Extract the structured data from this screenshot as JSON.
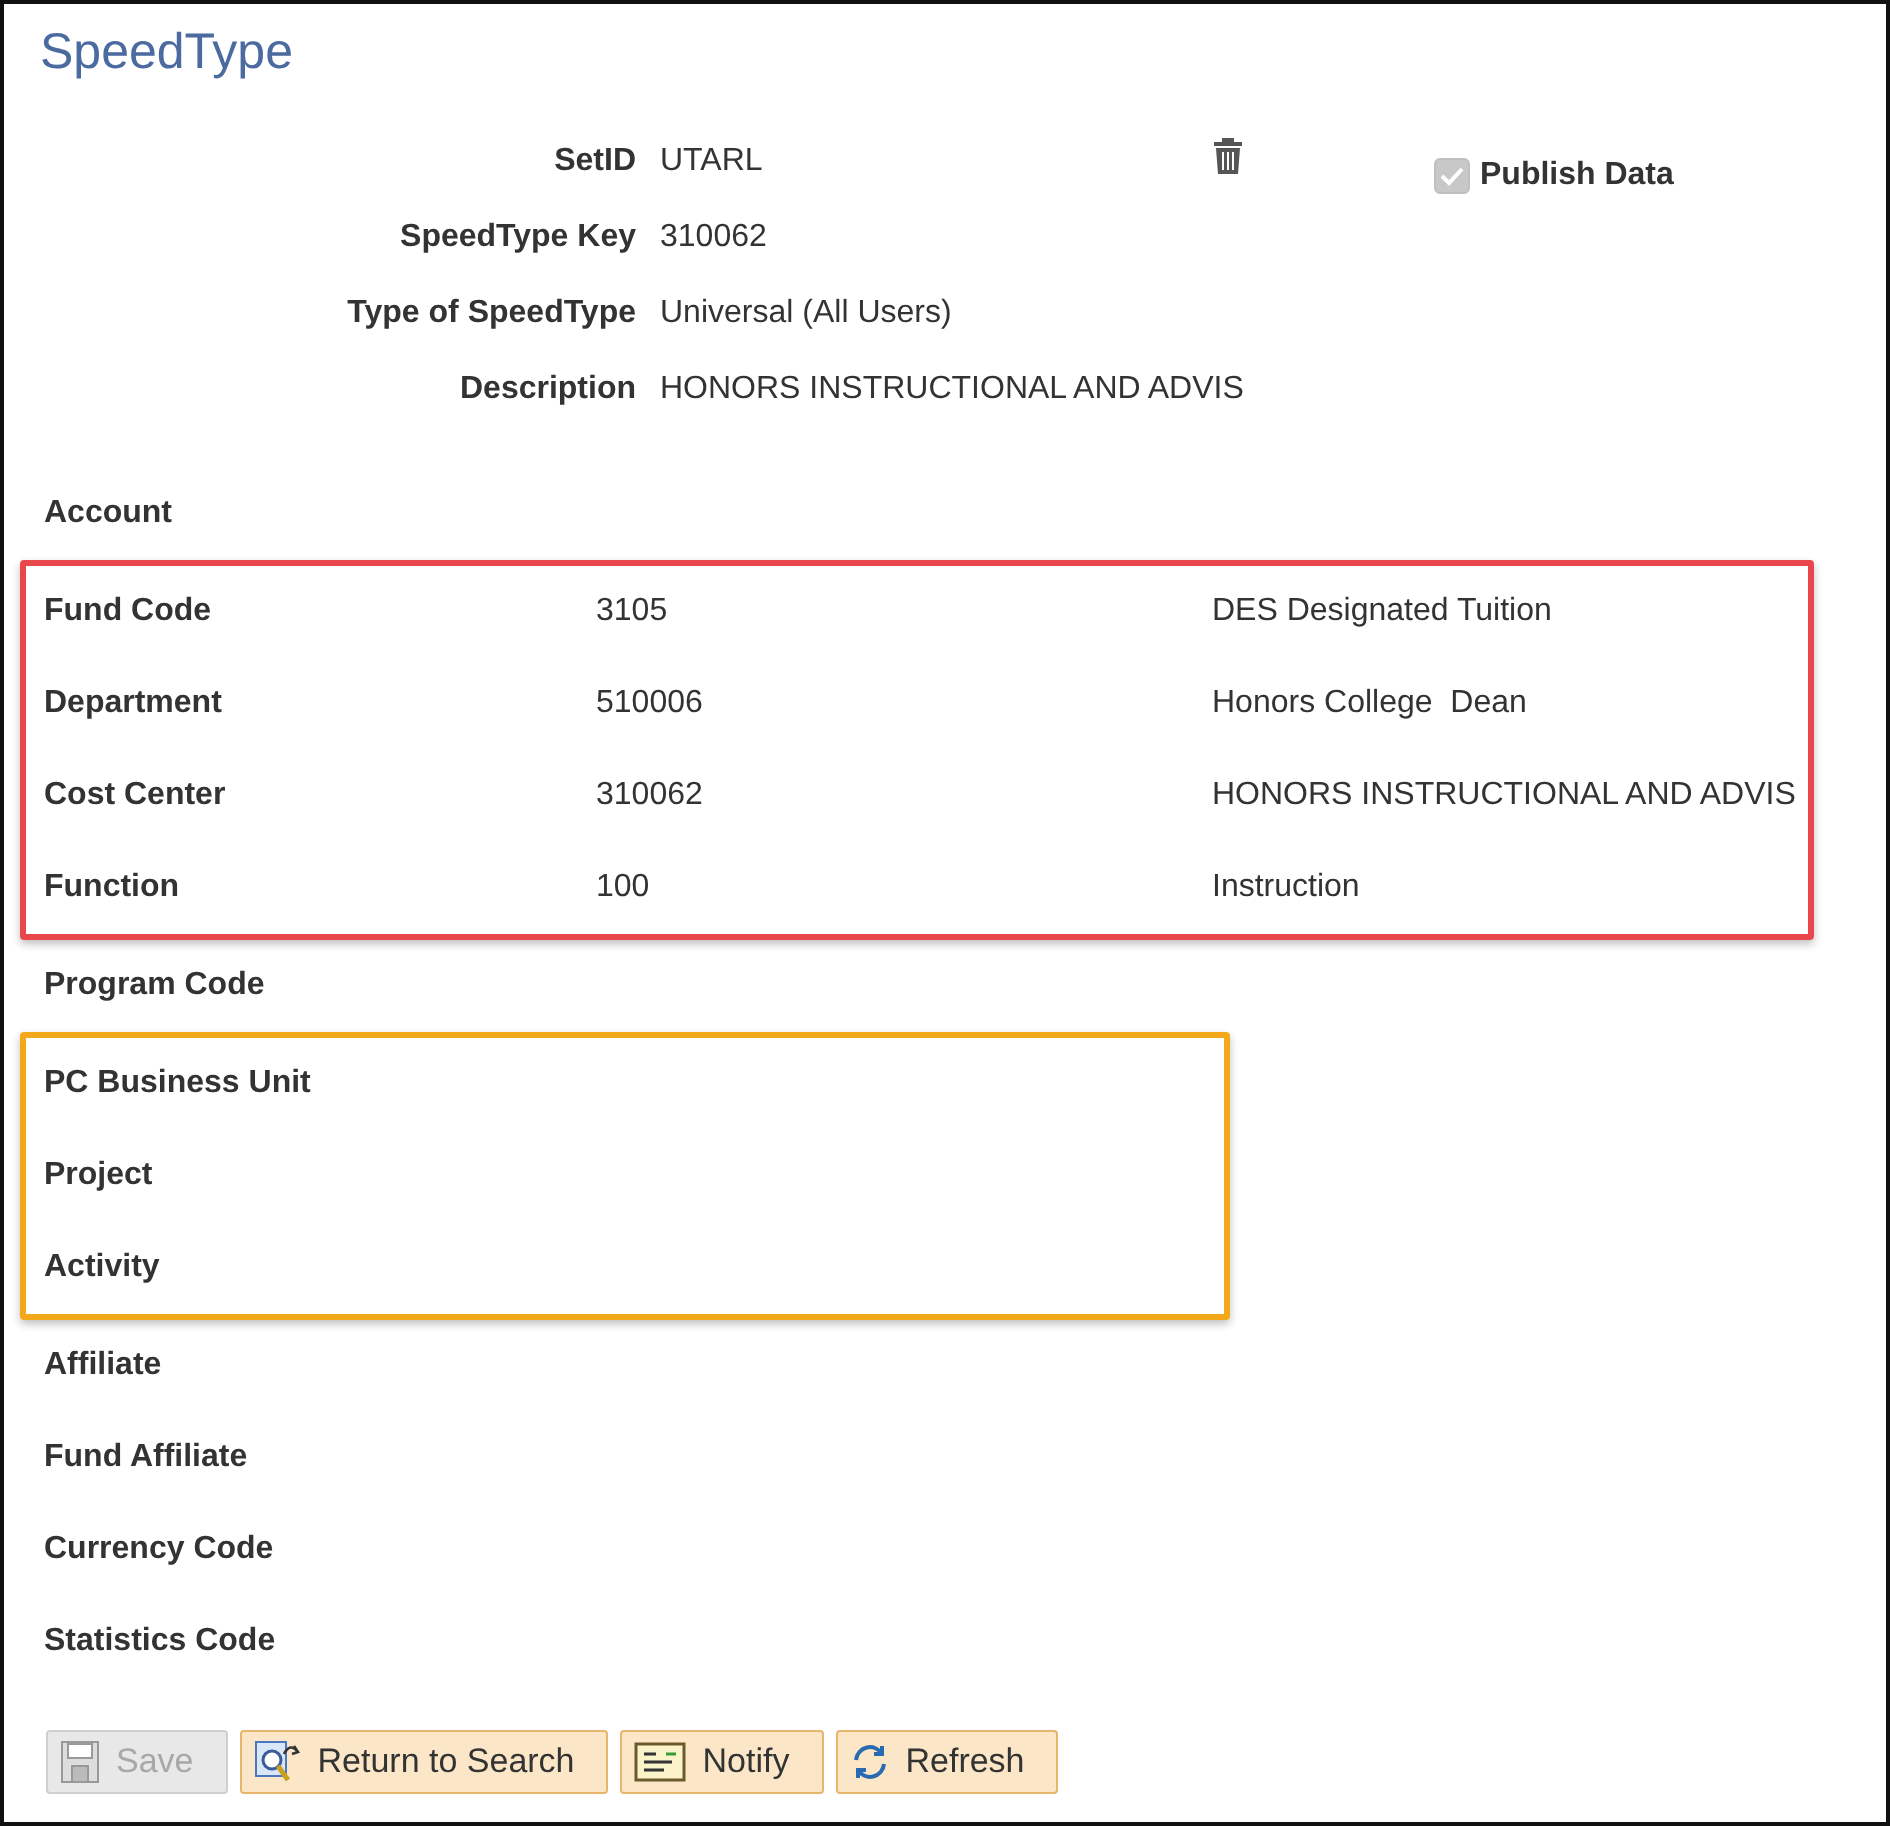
{
  "title": "SpeedType",
  "header_fields": [
    {
      "label": "SetID",
      "value": "UTARL"
    },
    {
      "label": "SpeedType Key",
      "value": "310062"
    },
    {
      "label": "Type of SpeedType",
      "value": "Universal (All Users)"
    },
    {
      "label": "Description",
      "value": "HONORS INSTRUCTIONAL AND ADVIS"
    }
  ],
  "publish_data": {
    "label": "Publish Data",
    "checked": true,
    "disabled": true
  },
  "field_groups": [
    {
      "rows": [
        {
          "label": "Account"
        }
      ]
    },
    {
      "color": "#e8474c",
      "rows": [
        {
          "label": "Fund Code",
          "value": "3105",
          "description": "DES Designated Tuition"
        },
        {
          "label": "Department",
          "value": "510006",
          "description": "Honors College  Dean"
        },
        {
          "label": "Cost Center",
          "value": "310062",
          "description": "HONORS INSTRUCTIONAL AND ADVIS"
        },
        {
          "label": "Function",
          "value": "100",
          "description": "Instruction"
        }
      ]
    },
    {
      "rows": [
        {
          "label": "Program Code"
        }
      ]
    },
    {
      "color": "#f2a818",
      "rows": [
        {
          "label": "PC Business Unit"
        },
        {
          "label": "Project"
        },
        {
          "label": "Activity"
        }
      ]
    },
    {
      "rows": [
        {
          "label": "Affiliate"
        },
        {
          "label": "Fund Affiliate"
        },
        {
          "label": "Currency Code"
        },
        {
          "label": "Statistics Code"
        }
      ]
    }
  ],
  "buttons": [
    {
      "kind": "save",
      "label": "Save",
      "disabled": true
    },
    {
      "kind": "search",
      "label": "Return to Search",
      "disabled": false
    },
    {
      "kind": "notify",
      "label": "Notify",
      "disabled": false
    },
    {
      "kind": "refresh",
      "label": "Refresh",
      "disabled": false
    }
  ]
}
